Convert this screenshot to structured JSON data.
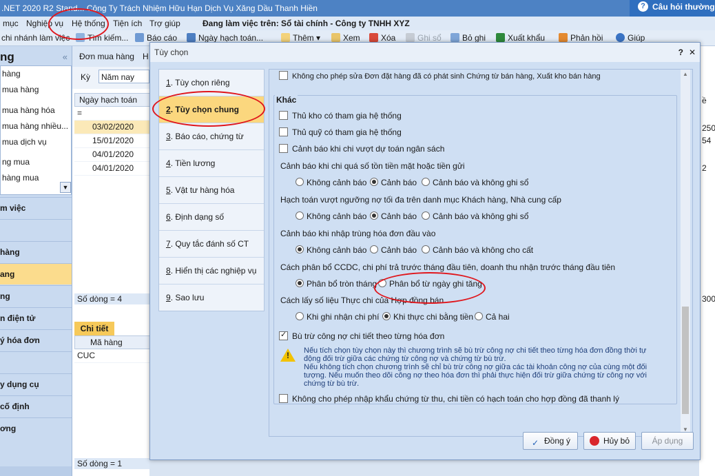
{
  "app": {
    "title": ".NET 2020 R2 Stand... Công Ty Trách Nhiệm Hữu Hạn Dịch Vụ Xăng Dầu Thanh Hiền",
    "help_label": "Câu hỏi thường g"
  },
  "menu": {
    "items": [
      "mục",
      "Nghiệp vụ",
      "Hệ thống",
      "Tiện ích",
      "Trợ giúp"
    ],
    "working_on": "Đang làm việc trên: Sổ tài chính - Công ty TNHH XYZ"
  },
  "toolbar": {
    "branch": "chi nhánh làm việc",
    "search": "Tìm kiếm...",
    "report": "Báo cáo",
    "posting_date": "Ngày hạch toán...",
    "add": "Thêm",
    "view": "Xem",
    "delete": "Xóa",
    "record": "Ghi sổ",
    "unrecord": "Bỏ ghi",
    "export": "Xuất khẩu",
    "feedback": "Phản hồi",
    "help": "Giúp"
  },
  "leftnav": {
    "header": "ng",
    "list": [
      "hàng",
      "mua hàng",
      "mua hàng hóa",
      "mua hàng nhiều...",
      "mua dịch vụ",
      "ng mua",
      "hàng mua"
    ],
    "groups": [
      "m việc",
      "",
      "hàng",
      "ang",
      "ng",
      "n điện tử",
      "ý hóa đơn",
      "",
      "y dụng cụ",
      "cố định",
      "ơng"
    ]
  },
  "midpane": {
    "tabs": [
      "Đơn mua hàng",
      "H"
    ],
    "ky_label": "Kỳ",
    "ky_value": "Năm nay",
    "col_header": "Ngày hạch toán",
    "filter_symbol": "=",
    "rows": [
      "03/02/2020",
      "15/01/2020",
      "04/01/2020",
      "04/01/2020"
    ],
    "so_dong_1": "Số dòng = 4",
    "chitiet": "Chi tiết",
    "col2_header": "Mã hàng",
    "col2_rows": [
      "CUC"
    ],
    "so_dong_2": "Số dòng = 1"
  },
  "rightstrip": {
    "header": "ề",
    "values": [
      "250",
      "54",
      "2",
      "300"
    ]
  },
  "dialog": {
    "title": "Tùy chọn",
    "help": "?",
    "close": "✕",
    "categories": [
      {
        "num": "1",
        "label": ". Tùy chọn riêng"
      },
      {
        "num": "2",
        "label": ". Tùy chọn chung"
      },
      {
        "num": "3",
        "label": ". Báo cáo, chứng từ"
      },
      {
        "num": "4",
        "label": ". Tiền lương"
      },
      {
        "num": "5",
        "label": ". Vật tư hàng hóa"
      },
      {
        "num": "6",
        "label": ". Định dạng số"
      },
      {
        "num": "7",
        "label": ". Quy tắc đánh số CT"
      },
      {
        "num": "8",
        "label": ". Hiển thị các nghiệp vụ"
      },
      {
        "num": "9",
        "label": ". Sao lưu"
      }
    ],
    "top_option": "Không cho phép sửa Đơn đặt hàng đã có phát sinh Chứng từ bán hàng, Xuất kho bán hàng",
    "group_title": "Khác",
    "chk_thukho": "Thủ kho có tham gia hệ thống",
    "chk_thuquy": "Thủ quỹ có tham gia hệ thống",
    "chk_canhbao": "Cảnh báo khi chi vượt dự toán ngân sách",
    "q1": "Cảnh báo khi chi quá số tồn tiền mặt hoặc tiền gửi",
    "q1_opts": [
      "Không cảnh báo",
      "Cảnh báo",
      "Cảnh báo và không ghi sổ"
    ],
    "q2": "Hạch toán vượt ngưỡng nợ tối đa trên danh mục Khách hàng, Nhà cung cấp",
    "q2_opts": [
      "Không cảnh báo",
      "Cảnh báo",
      "Cảnh báo và không ghi sổ"
    ],
    "q3": "Cảnh báo khi nhập trùng hóa đơn đầu vào",
    "q3_opts": [
      "Không cảnh báo",
      "Cảnh báo",
      "Cảnh báo và không cho cất"
    ],
    "q4": "Cách phân bổ CCDC, chi phí trả trước tháng đầu tiên, doanh thu nhận trước tháng đầu tiên",
    "q4_opts": [
      "Phân bổ tròn tháng",
      "Phân bổ từ ngày ghi tăng"
    ],
    "q5": "Cách lấy số liệu Thực chi của Hợp đồng bán",
    "q5_opts": [
      "Khi ghi nhận chi phí",
      "Khi thực chi bằng tiền",
      "Cả hai"
    ],
    "chk_butru": "Bù trừ công nợ chi tiết theo từng hóa đơn",
    "note_lines": [
      "Nếu tích chọn tùy chọn này thì chương trình sẽ bù trừ công nợ chi tiết theo từng hóa đơn đồng thời tự",
      "động đối trừ giữa các chứng từ công nợ và chứng từ bù trừ.",
      "Nếu không tích chọn chương trình sẽ chỉ bù trừ công nợ giữa các tài khoản công nợ của cùng một đối",
      "tượng. Nếu muốn theo dõi công nợ theo hóa đơn thì phải thực hiện đối trừ giữa chứng từ công nợ với",
      "chứng từ bù trừ."
    ],
    "chk_khongchophep": "Không cho phép nhập khẩu chứng từ thu, chi tiền có hạch toán cho hợp đồng đã thanh lý",
    "btn_ok": "Đồng ý",
    "btn_cancel": "Hủy bỏ",
    "btn_apply": "Áp dụng"
  },
  "colors": {
    "title_bar": "#4d82c4",
    "active_tab": "#fbd77e",
    "annotation": "#e0161c"
  }
}
